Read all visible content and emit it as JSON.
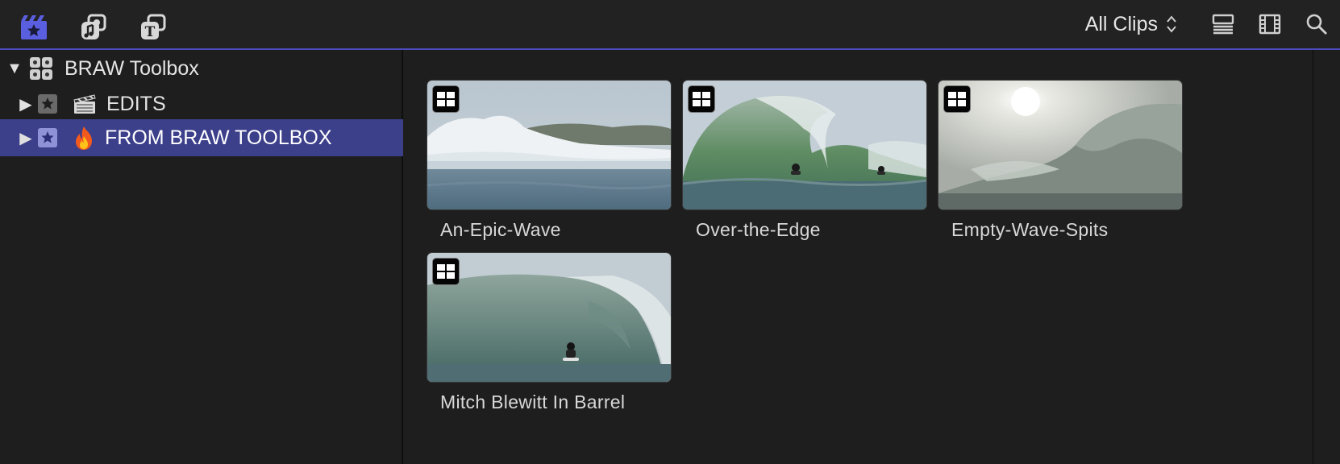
{
  "toolbar": {
    "left_buttons": [
      {
        "name": "libraries-icon",
        "label": "Libraries"
      },
      {
        "name": "photos-audio-icon",
        "label": "Photos and Audio"
      },
      {
        "name": "titles-generators-icon",
        "label": "Titles and Generators"
      }
    ],
    "filter_label": "All Clips",
    "right_buttons": [
      "clip-appearance-icon",
      "filmstrip-icon",
      "search-icon"
    ],
    "accent_color": "#4a4dba"
  },
  "sidebar": {
    "library": {
      "name": "BRAW Toolbox",
      "expanded": true
    },
    "items": [
      {
        "label": "EDITS",
        "icon": "clapper-icon",
        "selected": false
      },
      {
        "label": "FROM BRAW TOOLBOX",
        "icon": "fire-icon",
        "selected": true
      }
    ],
    "selection_color": "#3c3f8a"
  },
  "clips": [
    {
      "name": "An-Epic-Wave"
    },
    {
      "name": "Over-the-Edge"
    },
    {
      "name": "Empty-Wave-Spits"
    },
    {
      "name": "Mitch Blewitt In Barrel"
    }
  ]
}
